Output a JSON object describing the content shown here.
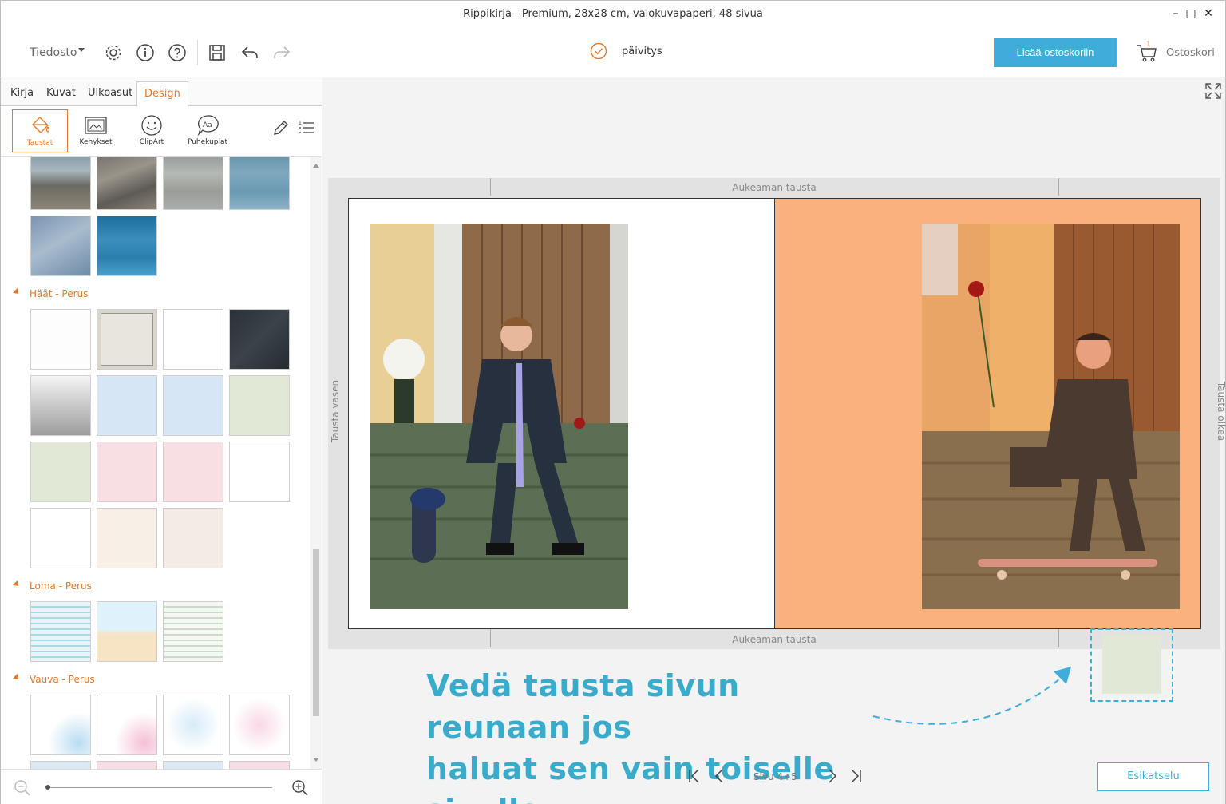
{
  "window": {
    "title": "Rippikirja - Premium, 28x28 cm, valokuvapaperi, 48 sivua",
    "minimize": "–",
    "maximize": "□",
    "close": "✕"
  },
  "toolbar": {
    "file_menu": "Tiedosto",
    "icons": [
      "gear-icon",
      "info-icon",
      "help-icon",
      "save-icon",
      "undo-icon",
      "redo-icon"
    ],
    "update_label": "päivitys",
    "add_to_cart": "Lisää ostoskoriin",
    "cart_count": "1",
    "cart_label": "Ostoskori"
  },
  "tabs": [
    {
      "label": "Kirja"
    },
    {
      "label": "Kuvat"
    },
    {
      "label": "Ulkoasut"
    },
    {
      "label": "Design"
    }
  ],
  "tools": [
    {
      "label": "Taustat",
      "icon": "paint-bucket-icon"
    },
    {
      "label": "Kehykset",
      "icon": "frame-icon"
    },
    {
      "label": "ClipArt",
      "icon": "clipart-icon"
    },
    {
      "label": "Puhekuplat",
      "icon": "speech-bubble-icon"
    }
  ],
  "sections": [
    {
      "label": "Häät - Perus"
    },
    {
      "label": "Loma - Perus"
    },
    {
      "label": "Vauva - Perus"
    }
  ],
  "canvas": {
    "top_label": "Aukeaman tausta",
    "bottom_label": "Aukeaman tausta",
    "left_label": "Tausta vasen",
    "right_label": "Tausta oikea",
    "right_page_color": "#f9b27e"
  },
  "hint": {
    "line1": "Vedä tausta sivun reunaan jos",
    "line2": "haluat sen vain toiselle sivulle."
  },
  "pager": {
    "label": "Sivu 4+5"
  },
  "preview_button": "Esikatselu",
  "colors": {
    "accent": "#e07a2a",
    "button": "#3eaed9"
  }
}
